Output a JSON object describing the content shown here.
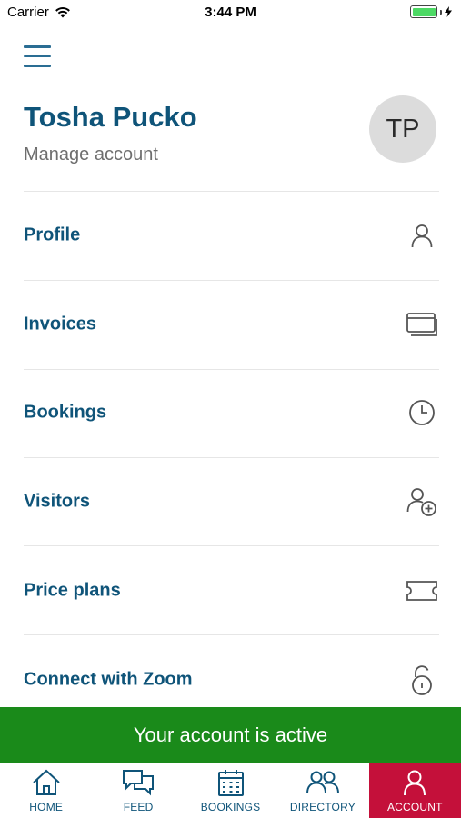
{
  "status_bar": {
    "carrier": "Carrier",
    "time": "3:44 PM"
  },
  "header": {
    "name": "Tosha Pucko",
    "subtitle": "Manage account",
    "initials": "TP"
  },
  "menu": {
    "items": [
      {
        "label": "Profile",
        "icon": "person-icon"
      },
      {
        "label": "Invoices",
        "icon": "cards-icon"
      },
      {
        "label": "Bookings",
        "icon": "clock-icon"
      },
      {
        "label": "Visitors",
        "icon": "add-person-icon"
      },
      {
        "label": "Price plans",
        "icon": "ticket-icon"
      },
      {
        "label": "Connect with Zoom",
        "icon": "unlock-icon"
      }
    ]
  },
  "banner": {
    "text": "Your account is active",
    "color": "#1a8a1a"
  },
  "tabbar": {
    "tabs": [
      {
        "label": "HOME",
        "icon": "home-icon"
      },
      {
        "label": "FEED",
        "icon": "chat-icon"
      },
      {
        "label": "BOOKINGS",
        "icon": "calendar-icon"
      },
      {
        "label": "DIRECTORY",
        "icon": "people-icon"
      },
      {
        "label": "ACCOUNT",
        "icon": "person-icon",
        "active": true
      }
    ]
  },
  "colors": {
    "brand": "#0f5479",
    "active_tab": "#c4103a",
    "icon_gray": "#555555"
  }
}
